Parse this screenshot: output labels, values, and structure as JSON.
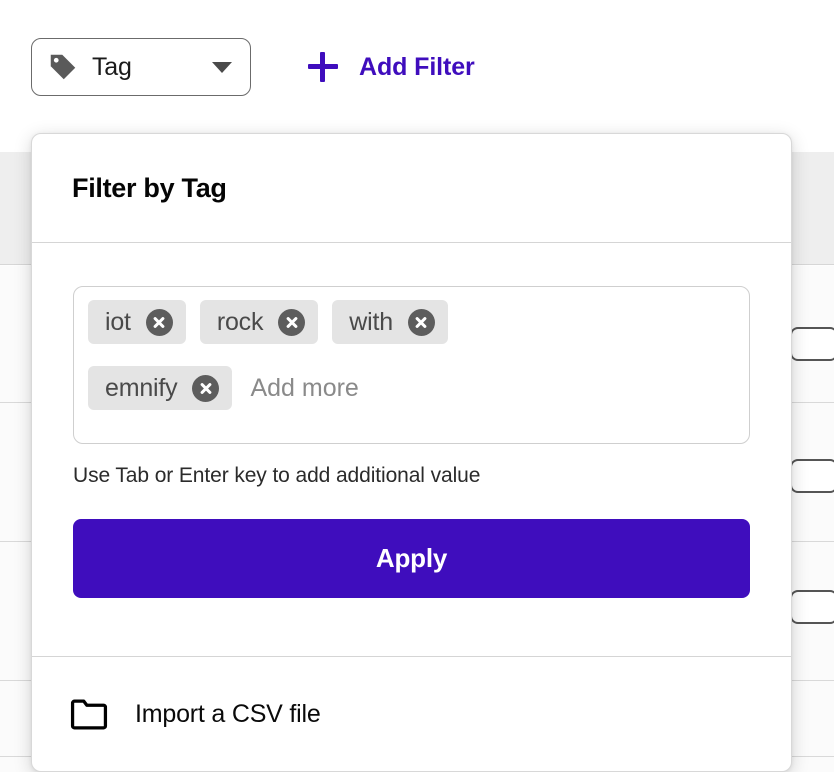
{
  "toolbar": {
    "tag_select": {
      "icon": "tag-icon",
      "label": "Tag",
      "caret": "chevron-down-icon"
    },
    "add_filter": {
      "icon": "plus-icon",
      "label": "Add Filter"
    }
  },
  "popover": {
    "title": "Filter by Tag",
    "tag_input": {
      "chips": [
        {
          "label": "iot",
          "remove_icon": "close-circle-icon"
        },
        {
          "label": "rock",
          "remove_icon": "close-circle-icon"
        },
        {
          "label": "with",
          "remove_icon": "close-circle-icon"
        },
        {
          "label": "emnify",
          "remove_icon": "close-circle-icon"
        }
      ],
      "value": "",
      "placeholder": "Add more"
    },
    "helper_text": "Use Tab or Enter key to add additional value",
    "apply_label": "Apply",
    "footer": {
      "icon": "folder-icon",
      "label": "Import a CSV file"
    }
  },
  "colors": {
    "accent_purple": "#3F0DBD",
    "chip_background": "#E4E4E4",
    "chip_text": "#4A4A4A",
    "chip_remove_circle": "#5D5D5D",
    "border_gray": "#CFCFCF",
    "table_header_gray": "#EEEEEE"
  }
}
